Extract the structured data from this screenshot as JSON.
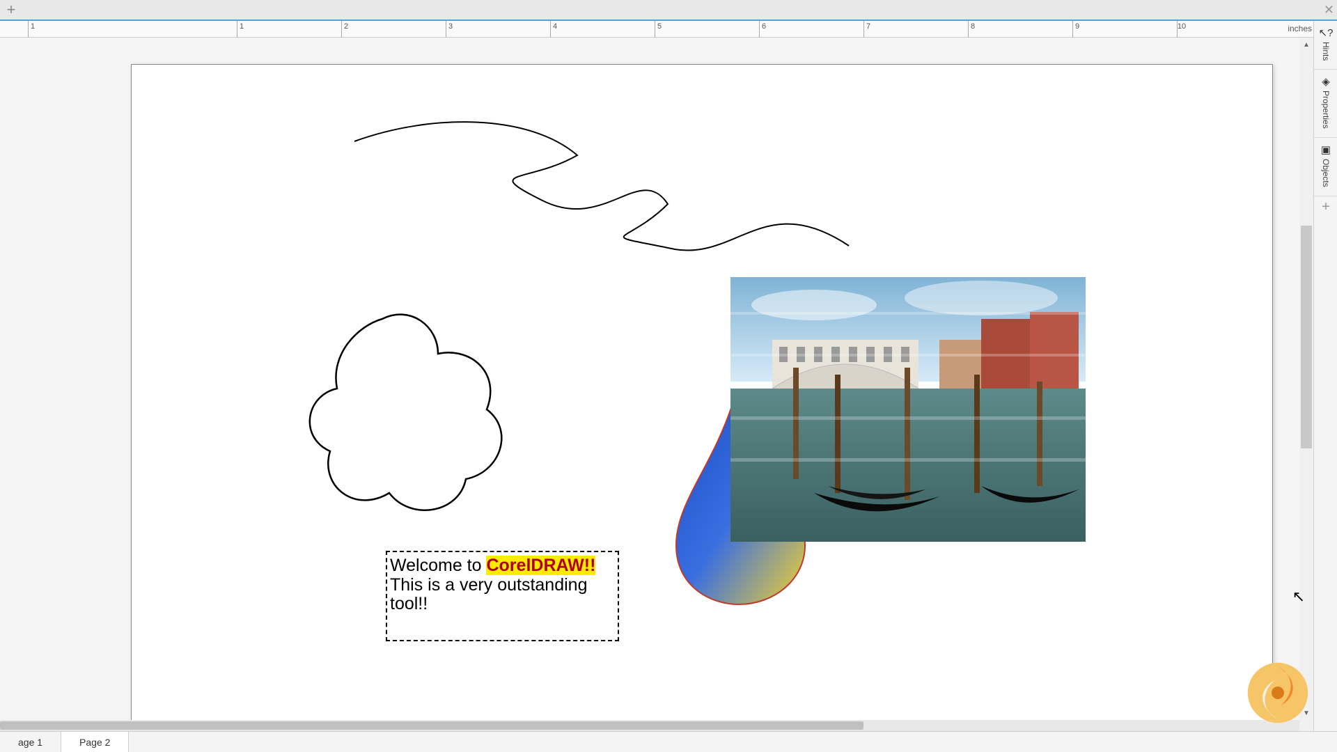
{
  "top": {
    "close_glyph": "✕",
    "add_glyph": "+"
  },
  "ruler": {
    "unit_label": "inches",
    "ticks": [
      "1",
      "1",
      "2",
      "3",
      "4",
      "5",
      "6",
      "7",
      "8",
      "9",
      "10"
    ]
  },
  "side_tabs": {
    "hints": "Hints",
    "properties": "Properties",
    "objects": "Objects",
    "add_glyph": "+"
  },
  "textframe": {
    "prefix": "Welcome to ",
    "highlight": "CorelDRAW!!",
    "rest": "This is a very outstanding tool!!"
  },
  "pages": {
    "p1": "age 1",
    "p2": "Page 2"
  },
  "icons": {
    "cursor": "▲",
    "help": "?",
    "diamond": "◈",
    "layers": "▣"
  }
}
